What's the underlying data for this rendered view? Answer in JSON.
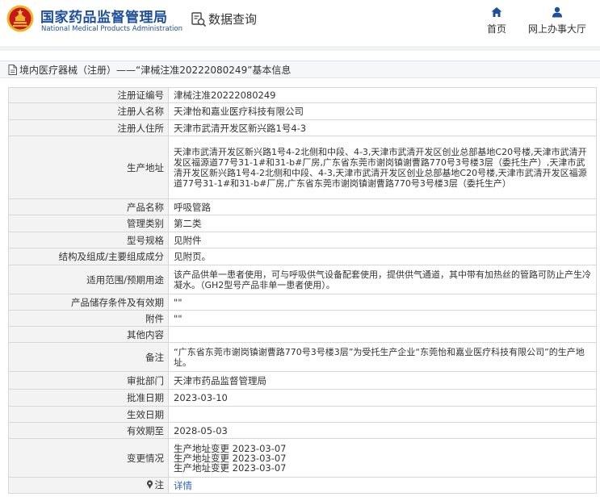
{
  "header": {
    "brand_cn": "国家药品监督管理局",
    "brand_en": "National Medical Products Administration",
    "query_label": "数据查询",
    "nav": [
      {
        "label": "首页",
        "icon": "home-icon"
      },
      {
        "label": "网上办事大厅",
        "icon": "person-icon"
      }
    ]
  },
  "breadcrumb": {
    "text": "境内医疗器械（注册）——“津械注准20222080249”基本信息",
    "icon": "document-icon"
  },
  "record": {
    "rows": [
      {
        "key": "注册证编号",
        "value": "津械注准20222080249"
      },
      {
        "key": "注册人名称",
        "value": "天津怡和嘉业医疗科技有限公司"
      },
      {
        "key": "注册人住所",
        "value": "天津市武清开发区新兴路1号4-3"
      },
      {
        "key": "生产地址",
        "value": "天津市武清开发区新兴路1号4-2北侧和中段、4-3,天津市武清开发区创业总部基地C20号楼,天津市武清开发区福源道77号31-1#和31-b#厂房,广东省东莞市谢岗镇谢曹路770号3号楼3层（委托生产）,天津市武清开发区新兴路1号4-2北侧和中段、4-3,天津市武清开发区创业总部基地C20号楼,天津市武清开发区福源道77号31-1#和31-b#厂房,广东省东莞市谢岗镇谢曹路770号3号楼3层（委托生产）"
      },
      {
        "key": "产品名称",
        "value": "呼吸管路"
      },
      {
        "key": "管理类别",
        "value": "第二类"
      },
      {
        "key": "型号规格",
        "value": "见附件"
      },
      {
        "key": "结构及组成/主要组成成分",
        "value": "见附页。"
      },
      {
        "key": "适用范围/预期用途",
        "value": "该产品供单一患者使用，可与呼吸供气设备配套使用，提供供气通道，其中带有加热丝的管路可防止产生冷凝水。（GH2型号产品非单一患者使用）。"
      },
      {
        "key": "产品储存条件及有效期",
        "value": "\"\""
      },
      {
        "key": "附件",
        "value": "\"\""
      },
      {
        "key": "其他内容",
        "value": ""
      },
      {
        "key": "备注",
        "value": "“广东省东莞市谢岗镇谢曹路770号3号楼3层”为受托生产企业“东莞怡和嘉业医疗科技有限公司”的生产地址。"
      },
      {
        "key": "审批部门",
        "value": "天津市药品监督管理局"
      },
      {
        "key": "批准日期",
        "value": "2023-03-10"
      },
      {
        "key": "生效日期",
        "value": ""
      },
      {
        "key": "有效期至",
        "value": "2028-05-03"
      }
    ],
    "changes_key": "变更情况",
    "changes": [
      "生产地址变更 2023-03-07",
      "生产地址变更 2023-03-07",
      "生产地址变更 2023-03-07"
    ],
    "note_key": "注",
    "note_icon": "pin-icon",
    "note_link": "详情"
  },
  "colors": {
    "brand_blue": "#1d4f9c",
    "logo_red": "#c8161d",
    "logo_gold": "#e8b628",
    "link_blue": "#2b63c6",
    "label_bg": "#f3f3f3",
    "border": "#d8d8d8"
  }
}
